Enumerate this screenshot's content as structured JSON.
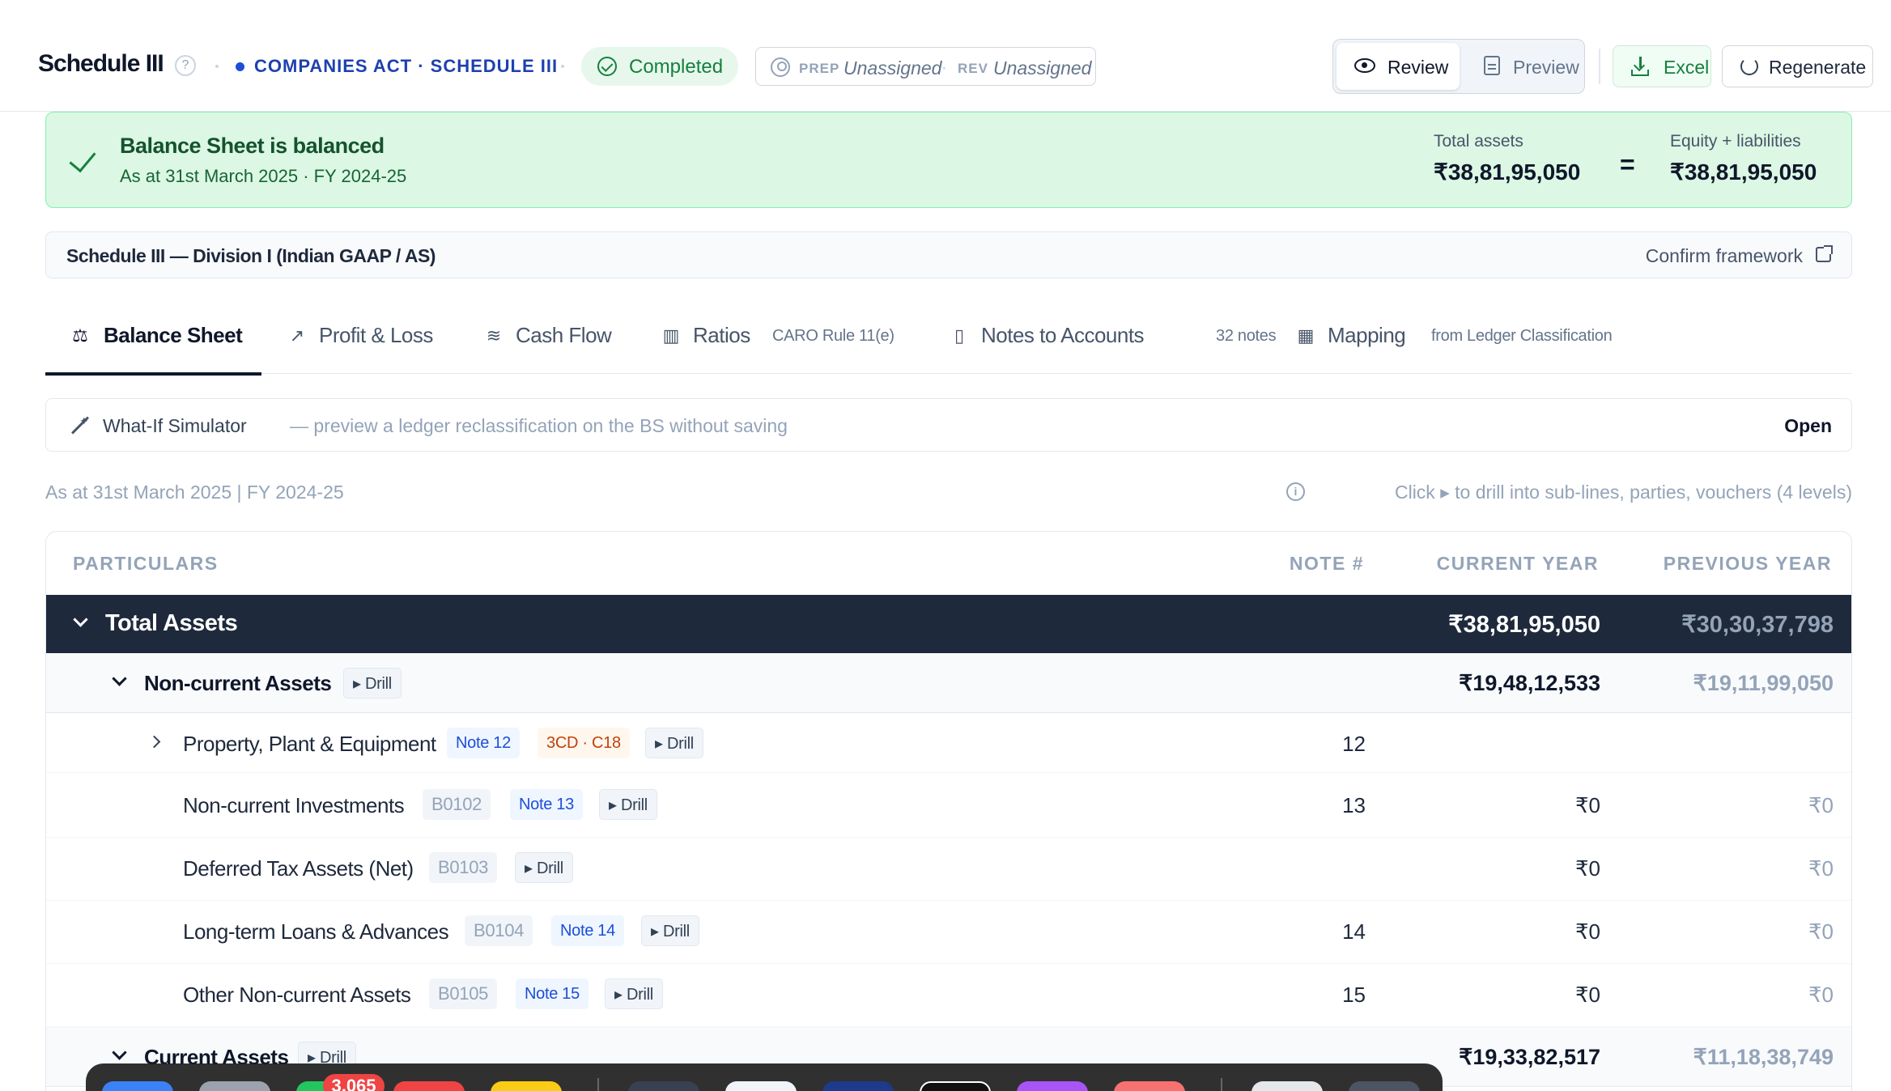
{
  "header": {
    "title": "Schedule III",
    "act_label": "COMPANIES ACT · SCHEDULE III",
    "status": "Completed",
    "prep_label": "PREP",
    "prep_value": "Unassigned",
    "assign_sep": "·",
    "rev_label": "REV",
    "rev_value": "Unassigned",
    "review_label": "Review",
    "preview_label": "Preview",
    "excel_label": "Excel",
    "regenerate_label": "Regenerate"
  },
  "banner": {
    "title": "Balance Sheet is balanced",
    "subtitle": "As at 31st March 2025 · FY 2024-25",
    "total_assets_label": "Total assets",
    "total_assets_value": "₹38,81,95,050",
    "equals": "=",
    "equity_label": "Equity + liabilities",
    "equity_value": "₹38,81,95,050"
  },
  "framework": {
    "name": "Schedule III — Division I (Indian GAAP / AS)",
    "confirm": "Confirm framework"
  },
  "tabs": [
    {
      "label": "Balance Sheet",
      "meta": "",
      "icon": "scale-icon"
    },
    {
      "label": "Profit & Loss",
      "meta": "",
      "icon": "trend-up-icon"
    },
    {
      "label": "Cash Flow",
      "meta": "",
      "icon": "waves-icon"
    },
    {
      "label": "Ratios",
      "meta": "CARO Rule 11(e)",
      "icon": "bar-chart-icon"
    },
    {
      "label": "Notes to Accounts",
      "meta": "32 notes",
      "icon": "file-icon"
    },
    {
      "label": "Mapping",
      "meta": "from Ledger Classification",
      "icon": "map-icon"
    }
  ],
  "whatif": {
    "title": "What-If Simulator",
    "desc": "— preview a ledger reclassification on the BS without saving",
    "open": "Open"
  },
  "meta": {
    "as_at": "As at 31st March 2025 | FY 2024-25",
    "hint": "Click ▸ to drill into sub-lines, parties, vouchers (4 levels)"
  },
  "table": {
    "headers": {
      "particulars": "PARTICULARS",
      "note": "NOTE #",
      "current": "CURRENT YEAR",
      "previous": "PREVIOUS YEAR"
    },
    "drill_label": "▸ Drill",
    "total": {
      "label": "Total Assets",
      "current": "₹38,81,95,050",
      "previous": "₹30,30,37,798"
    },
    "non_current": {
      "label": "Non-current Assets",
      "current": "₹19,48,12,533",
      "previous": "₹19,11,99,050"
    },
    "items": [
      {
        "label": "Property, Plant & Equipment",
        "code": "",
        "note_chip": "Note 12",
        "cd_chip": "3CD · C18",
        "note": "12",
        "current": "",
        "previous": ""
      },
      {
        "label": "Non-current Investments",
        "code": "B0102",
        "note_chip": "Note 13",
        "cd_chip": "",
        "note": "13",
        "current": "₹0",
        "previous": "₹0"
      },
      {
        "label": "Deferred Tax Assets (Net)",
        "code": "B0103",
        "note_chip": "",
        "cd_chip": "",
        "note": "",
        "current": "₹0",
        "previous": "₹0"
      },
      {
        "label": "Long-term Loans & Advances",
        "code": "B0104",
        "note_chip": "Note 14",
        "cd_chip": "",
        "note": "14",
        "current": "₹0",
        "previous": "₹0"
      },
      {
        "label": "Other Non-current Assets",
        "code": "B0105",
        "note_chip": "Note 15",
        "cd_chip": "",
        "note": "15",
        "current": "₹0",
        "previous": "₹0"
      }
    ],
    "current_assets": {
      "label": "Current Assets",
      "current": "₹19,33,82,517",
      "previous": "₹11,18,38,749"
    }
  },
  "dock": {
    "badge": "3,065"
  }
}
